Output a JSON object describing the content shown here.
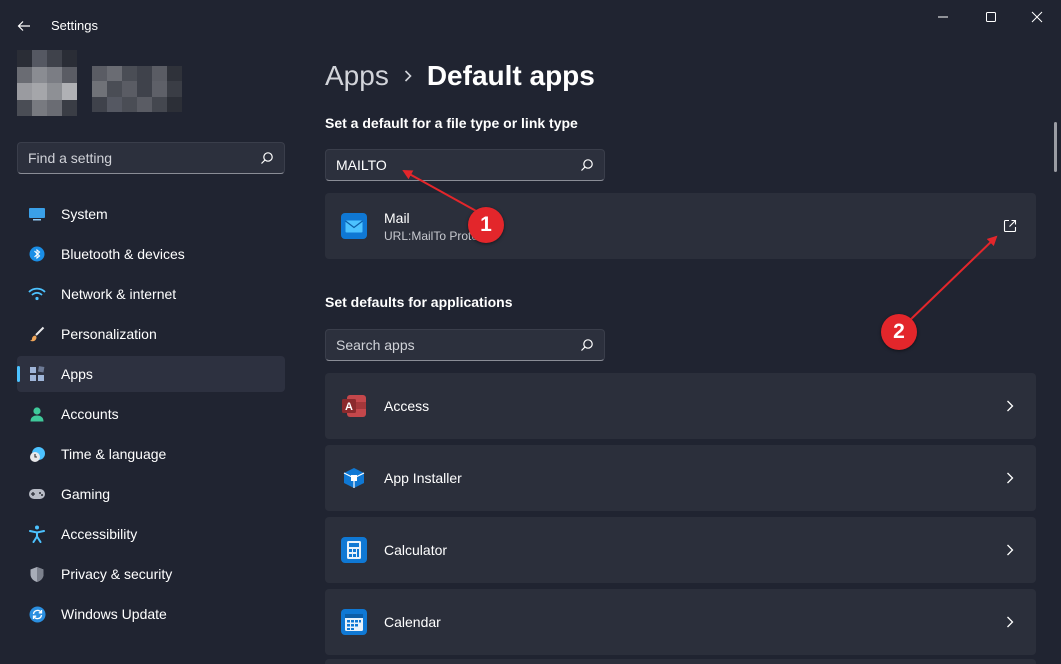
{
  "window": {
    "title": "Settings",
    "minimize_icon": "minimize-icon",
    "maximize_icon": "maximize-icon",
    "close_icon": "close-icon"
  },
  "profile": {
    "avatar": "pixelated-avatar",
    "name_blurred": true
  },
  "sidebar": {
    "search_placeholder": "Find a setting",
    "items": [
      {
        "label": "System",
        "icon": "system-icon",
        "color": "#3aa0e8"
      },
      {
        "label": "Bluetooth & devices",
        "icon": "bluetooth-icon",
        "color": "#1a8ee6"
      },
      {
        "label": "Network & internet",
        "icon": "wifi-icon",
        "color": "#4cc2ff"
      },
      {
        "label": "Personalization",
        "icon": "brush-icon",
        "color": "#f0a65a"
      },
      {
        "label": "Apps",
        "icon": "apps-icon",
        "color": "#9fb5d8",
        "active": true
      },
      {
        "label": "Accounts",
        "icon": "person-icon",
        "color": "#3fc99a"
      },
      {
        "label": "Time & language",
        "icon": "clock-globe-icon",
        "color": "#4cc2ff"
      },
      {
        "label": "Gaming",
        "icon": "gamepad-icon",
        "color": "#b8bcc6"
      },
      {
        "label": "Accessibility",
        "icon": "accessibility-icon",
        "color": "#4cc2ff"
      },
      {
        "label": "Privacy & security",
        "icon": "shield-icon",
        "color": "#a8adb8"
      },
      {
        "label": "Windows Update",
        "icon": "update-icon",
        "color": "#2b8fe0"
      }
    ]
  },
  "main": {
    "breadcrumb_parent": "Apps",
    "page_title": "Default apps",
    "file_type_section_label": "Set a default for a file type or link type",
    "file_type_search_value": "MAILTO",
    "result": {
      "title": "Mail",
      "subtitle": "URL:MailTo Proto",
      "icon": "mail-icon",
      "action_icon": "open-external-icon"
    },
    "apps_section_label": "Set defaults for applications",
    "apps_search_placeholder": "Search apps",
    "apps": [
      {
        "label": "Access",
        "icon": "access-icon",
        "color": "#a4373a"
      },
      {
        "label": "App Installer",
        "icon": "app-installer-icon",
        "color": "#0f78d4"
      },
      {
        "label": "Calculator",
        "icon": "calculator-icon",
        "color": "#0f78d4"
      },
      {
        "label": "Calendar",
        "icon": "calendar-icon",
        "color": "#0f78d4"
      }
    ]
  },
  "annotations": [
    {
      "number": "1",
      "color": "#e3262b"
    },
    {
      "number": "2",
      "color": "#e3262b"
    }
  ]
}
